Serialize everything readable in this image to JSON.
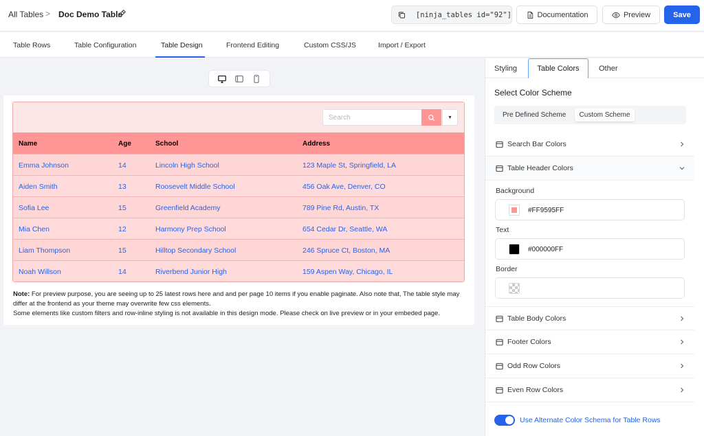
{
  "breadcrumb": {
    "root": "All Tables",
    "separator": ">",
    "title": "Doc Demo Table"
  },
  "toolbar": {
    "shortcode": "[ninja_tables id=\"92\"]",
    "documentation_label": "Documentation",
    "preview_label": "Preview",
    "save_label": "Save"
  },
  "nav": {
    "tabs": [
      {
        "label": "Table Rows"
      },
      {
        "label": "Table Configuration"
      },
      {
        "label": "Table Design",
        "active": true
      },
      {
        "label": "Frontend Editing"
      },
      {
        "label": "Custom CSS/JS"
      },
      {
        "label": "Import / Export"
      }
    ]
  },
  "devices": [
    "desktop-icon",
    "tablet-icon",
    "mobile-icon"
  ],
  "preview": {
    "search_placeholder": "Search",
    "columns": [
      "Name",
      "Age",
      "School",
      "Address"
    ],
    "rows": [
      [
        "Emma Johnson",
        "14",
        "Lincoln High School",
        "123 Maple St, Springfield, LA"
      ],
      [
        "Aiden Smith",
        "13",
        "Roosevelt Middle School",
        "456 Oak Ave, Denver, CO"
      ],
      [
        "Sofia Lee",
        "15",
        "Greenfield Academy",
        "789 Pine Rd, Austin, TX"
      ],
      [
        "Mia Chen",
        "12",
        "Harmony Prep School",
        "654 Cedar Dr, Seattle, WA"
      ],
      [
        "Liam Thompson",
        "15",
        "Hilltop Secondary School",
        "246 Spruce Ct, Boston, MA"
      ],
      [
        "Noah Willson",
        "14",
        "Riverbend Junior High",
        "159 Aspen Way, Chicago, IL"
      ]
    ],
    "note_label": "Note:",
    "note_line1": " For preview purpose, you are seeing up to 25 latest rows here and and per page 10 items if you enable paginate. Also note that, The table style may differ at the frontend as your theme may overwrite few css elements.",
    "note_line2": "Some elements like custom filters and row-inline styling is not available in this design mode. Please check on live preview or in your embeded page."
  },
  "panel": {
    "tabs": [
      "Styling",
      "Table Colors",
      "Other"
    ],
    "active_tab": "Table Colors",
    "scheme_title": "Select Color Scheme",
    "scheme_options": [
      "Pre Defined Scheme",
      "Custom Scheme"
    ],
    "active_scheme": "Custom Scheme",
    "sections": {
      "search_bar": "Search Bar Colors",
      "table_header": "Table Header Colors",
      "table_body": "Table Body Colors",
      "footer": "Footer Colors",
      "odd_row": "Odd Row Colors",
      "even_row": "Even Row Colors"
    },
    "header_fields": {
      "background_label": "Background",
      "background_value": "#FF9595FF",
      "text_label": "Text",
      "text_value": "#000000FF",
      "border_label": "Border"
    },
    "toggle_label": "Use Alternate Color Schema for Table Rows",
    "toggle_on": true
  },
  "colors": {
    "accent": "#2563eb",
    "header_bg": "#ff9595",
    "search_bar_bg": "#fde6e6",
    "row_bg": "#ffd6d6"
  }
}
